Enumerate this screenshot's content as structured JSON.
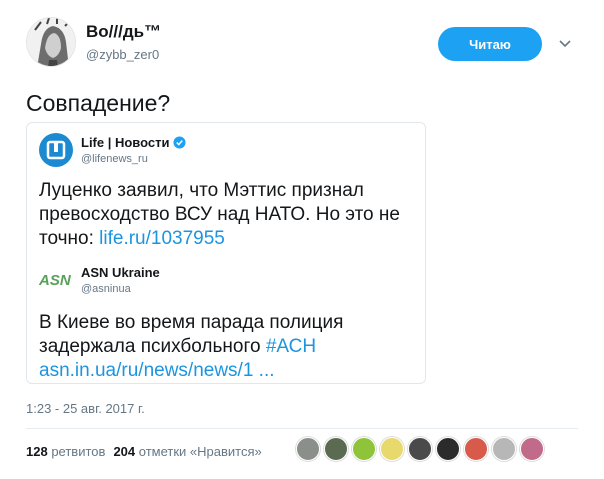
{
  "author": {
    "name": "Bo///дь™",
    "handle": "@zybb_zer0",
    "follow_label": "Читаю"
  },
  "tweet": {
    "text": "Совпадение?",
    "timestamp": "1:23 - 25 авг. 2017 г."
  },
  "quoted": {
    "name": "Life | Новости",
    "handle": "@lifenews_ru",
    "text_lead": "Луценко заявил, что Мэттис признал превосходство ВСУ над НАТО. Но это не точно: ",
    "link": "life.ru/1037955",
    "avatar_color": "#1b8ad1"
  },
  "nested": {
    "name": "ASN Ukraine",
    "handle": "@asninua",
    "logo_text": "ASN",
    "text_lead": "В Киеве во время парада полиция задержала психбольного ",
    "hashtag": "#АСН",
    "link": "asn.in.ua/ru/news/news/1   ..."
  },
  "stats": {
    "retweets_count": "128",
    "retweets_label": "ретвитов",
    "likes_count": "204",
    "likes_label": "отметки «Нравится»"
  },
  "likers": [
    {
      "color": "#8a8f8a",
      "icon": "avatar-icon"
    },
    {
      "color": "#5b6b52",
      "icon": "avatar-icon"
    },
    {
      "color": "#8fc43a",
      "icon": "avatar-icon"
    },
    {
      "color": "#e7d96b",
      "icon": "avatar-icon"
    },
    {
      "color": "#4a4a4a",
      "icon": "avatar-icon"
    },
    {
      "color": "#2b2b2b",
      "icon": "avatar-icon"
    },
    {
      "color": "#d85a4a",
      "icon": "avatar-icon"
    },
    {
      "color": "#b7b7b7",
      "icon": "avatar-icon"
    },
    {
      "color": "#c26a8a",
      "icon": "avatar-icon"
    }
  ],
  "colors": {
    "accent": "#1da1f2",
    "link": "#1b95e0",
    "verified": "#1da1f2"
  }
}
